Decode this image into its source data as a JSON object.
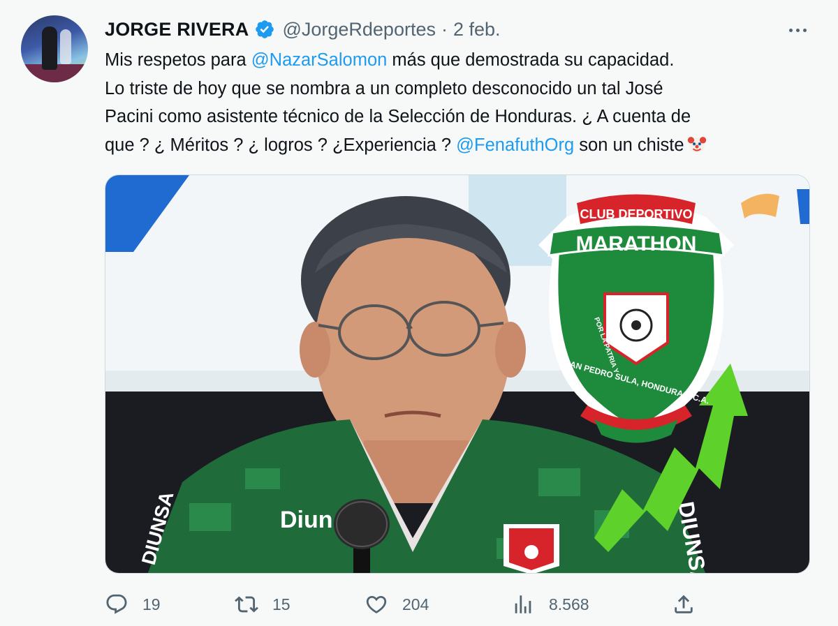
{
  "author": {
    "name": "JORGE RIVERA",
    "handle": "@JorgeRdeportes",
    "separator": "·",
    "date": "2 feb."
  },
  "tweet": {
    "line1_prefix": "Mis respetos para ",
    "mention1": "@NazarSalomon",
    "line1_suffix": " más que demostrada su capacidad.",
    "line2": "Lo triste de hoy que se nombra a un completo desconocido un tal José",
    "line3": "Pacini como asistente técnico de la Selección de Honduras. ¿ A cuenta de",
    "line4_prefix": "que ? ¿ Méritos ? ¿ logros ? ¿Experiencia ? ",
    "mention2": "@FenafuthOrg",
    "line4_suffix": " son un chiste",
    "emoji": "clown-face-icon"
  },
  "media": {
    "crest_top": "CLUB DEPORTIVO",
    "crest_name": "MARATHON",
    "crest_motto": "POR LA PATRIA Y",
    "crest_bottom": "SAN PEDRO SULA, HONDURAS, C.A.",
    "jersey_sponsor": "Diun",
    "jersey_side_text": "DIUNSA",
    "jersey_side_left": "DIUNSA",
    "crest_colors": {
      "green": "#1e8a3c",
      "red": "#d7242a"
    },
    "arrow_color": "#5fd12b"
  },
  "actions": {
    "replies": "19",
    "retweets": "15",
    "likes": "204",
    "views": "8.568"
  },
  "colors": {
    "accent": "#1d9bf0",
    "muted": "#536471",
    "text": "#0f1419"
  }
}
